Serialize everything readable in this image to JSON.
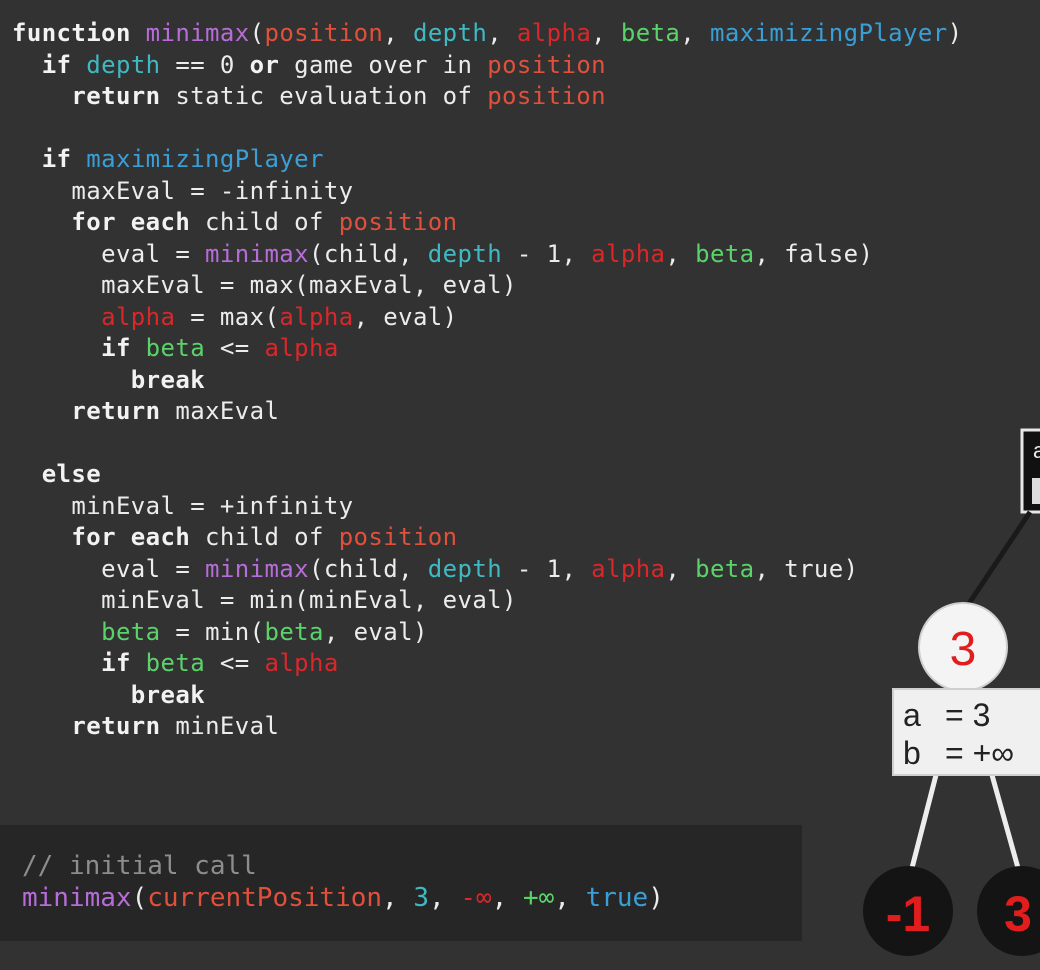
{
  "code": {
    "lines": [
      [
        {
          "t": "function ",
          "c": "kw"
        },
        {
          "t": "minimax",
          "c": "fn"
        },
        {
          "t": "("
        },
        {
          "t": "position",
          "c": "pos"
        },
        {
          "t": ", "
        },
        {
          "t": "depth",
          "c": "dep"
        },
        {
          "t": ", "
        },
        {
          "t": "alpha",
          "c": "alp"
        },
        {
          "t": ", "
        },
        {
          "t": "beta",
          "c": "bet"
        },
        {
          "t": ", "
        },
        {
          "t": "maximizingPlayer",
          "c": "mp"
        },
        {
          "t": ")"
        }
      ],
      [
        {
          "t": "  "
        },
        {
          "t": "if ",
          "c": "kw"
        },
        {
          "t": "depth",
          "c": "dep"
        },
        {
          "t": " == 0 "
        },
        {
          "t": "or",
          "c": "kw"
        },
        {
          "t": " game over in "
        },
        {
          "t": "position",
          "c": "pos"
        }
      ],
      [
        {
          "t": "    "
        },
        {
          "t": "return",
          "c": "kw"
        },
        {
          "t": " static evaluation of "
        },
        {
          "t": "position",
          "c": "pos"
        }
      ],
      [],
      [
        {
          "t": "  "
        },
        {
          "t": "if ",
          "c": "kw"
        },
        {
          "t": "maximizingPlayer",
          "c": "mp"
        }
      ],
      [
        {
          "t": "    maxEval = -infinity"
        }
      ],
      [
        {
          "t": "    "
        },
        {
          "t": "for each",
          "c": "kw"
        },
        {
          "t": " child of "
        },
        {
          "t": "position",
          "c": "pos"
        }
      ],
      [
        {
          "t": "      eval = "
        },
        {
          "t": "minimax",
          "c": "fn"
        },
        {
          "t": "(child, "
        },
        {
          "t": "depth",
          "c": "dep"
        },
        {
          "t": " - 1, "
        },
        {
          "t": "alpha",
          "c": "alp"
        },
        {
          "t": ", "
        },
        {
          "t": "beta",
          "c": "bet"
        },
        {
          "t": ", false)"
        }
      ],
      [
        {
          "t": "      maxEval = max(maxEval, eval)"
        }
      ],
      [
        {
          "t": "      "
        },
        {
          "t": "alpha",
          "c": "alp"
        },
        {
          "t": " = max("
        },
        {
          "t": "alpha",
          "c": "alp"
        },
        {
          "t": ", eval)"
        }
      ],
      [
        {
          "t": "      "
        },
        {
          "t": "if ",
          "c": "kw"
        },
        {
          "t": "beta",
          "c": "bet"
        },
        {
          "t": " <= "
        },
        {
          "t": "alpha",
          "c": "alp"
        }
      ],
      [
        {
          "t": "        "
        },
        {
          "t": "break",
          "c": "kw"
        }
      ],
      [
        {
          "t": "    "
        },
        {
          "t": "return",
          "c": "kw"
        },
        {
          "t": " maxEval"
        }
      ],
      [],
      [
        {
          "t": "  "
        },
        {
          "t": "else",
          "c": "kw"
        }
      ],
      [
        {
          "t": "    minEval = +infinity"
        }
      ],
      [
        {
          "t": "    "
        },
        {
          "t": "for each",
          "c": "kw"
        },
        {
          "t": " child of "
        },
        {
          "t": "position",
          "c": "pos"
        }
      ],
      [
        {
          "t": "      eval = "
        },
        {
          "t": "minimax",
          "c": "fn"
        },
        {
          "t": "(child, "
        },
        {
          "t": "depth",
          "c": "dep"
        },
        {
          "t": " - 1, "
        },
        {
          "t": "alpha",
          "c": "alp"
        },
        {
          "t": ", "
        },
        {
          "t": "beta",
          "c": "bet"
        },
        {
          "t": ", true)"
        }
      ],
      [
        {
          "t": "      minEval = min(minEval, eval)"
        }
      ],
      [
        {
          "t": "      "
        },
        {
          "t": "beta",
          "c": "bet"
        },
        {
          "t": " = min("
        },
        {
          "t": "beta",
          "c": "bet"
        },
        {
          "t": ", eval)"
        }
      ],
      [
        {
          "t": "      "
        },
        {
          "t": "if ",
          "c": "kw"
        },
        {
          "t": "beta",
          "c": "bet"
        },
        {
          "t": " <= "
        },
        {
          "t": "alpha",
          "c": "alp"
        }
      ],
      [
        {
          "t": "        "
        },
        {
          "t": "break",
          "c": "kw"
        }
      ],
      [
        {
          "t": "    "
        },
        {
          "t": "return",
          "c": "kw"
        },
        {
          "t": " minEval"
        }
      ]
    ]
  },
  "initial_call": {
    "comment": "// initial call",
    "fn": "minimax",
    "open": "(",
    "arg_position": "currentPosition",
    "sep1": ", ",
    "arg_depth": "3",
    "sep2": ", ",
    "arg_alpha": "-∞",
    "sep3": ", ",
    "arg_beta": "+∞",
    "sep4": ", ",
    "arg_max": "true",
    "close": ")"
  },
  "tree": {
    "node_value": "3",
    "alpha_label": "a",
    "alpha_value": "= 3",
    "beta_label": "b",
    "beta_value": "= +∞",
    "top_box_letter": "a",
    "leaf_left": "-1",
    "leaf_right": "3"
  },
  "colors": {
    "background": "#323232",
    "function_name": "#b76cd9",
    "position": "#e0503a",
    "depth": "#3fb9c2",
    "alpha": "#d9272a",
    "beta": "#5ad36a",
    "maximizingPlayer": "#3a9fd6",
    "node_value_red": "#e21d1d"
  }
}
